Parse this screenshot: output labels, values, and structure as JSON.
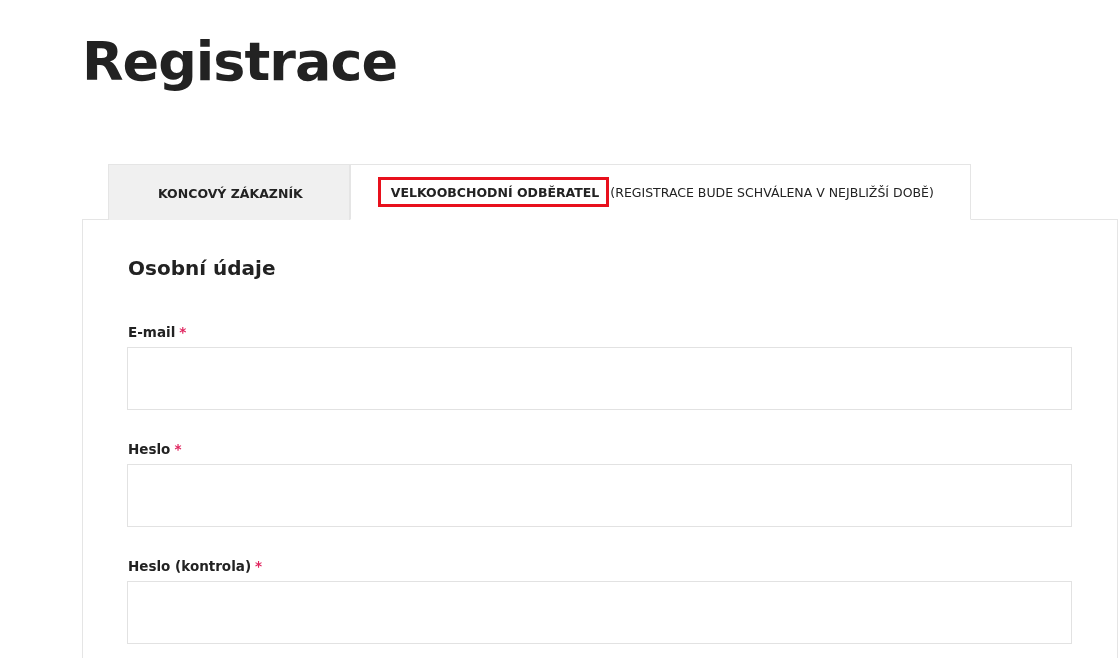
{
  "page_title": "Registrace",
  "tabs": [
    {
      "label": "KONCOVÝ ZÁKAZNÍK",
      "selected": false,
      "highlighted": false
    },
    {
      "label": "VELKOOBCHODNÍ ODBĚRATEL",
      "note": "(REGISTRACE BUDE SCHVÁLENA V NEJBLIŽŠÍ DOBĚ)",
      "selected": true,
      "highlighted": true
    }
  ],
  "section": {
    "heading": "Osobní údaje",
    "fields": [
      {
        "label": "E-mail",
        "required_mark": "*"
      },
      {
        "label": "Heslo",
        "required_mark": "*"
      },
      {
        "label": "Heslo (kontrola)",
        "required_mark": "*"
      }
    ]
  }
}
